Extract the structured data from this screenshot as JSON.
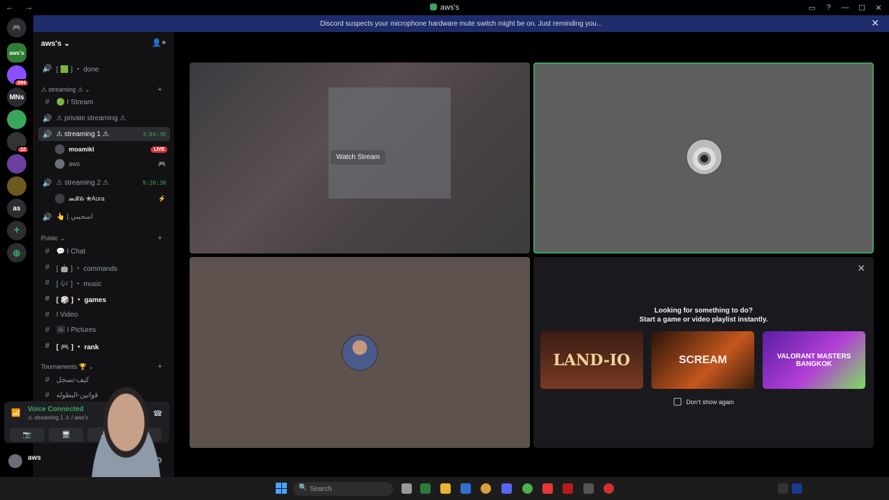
{
  "window": {
    "title": "aws's",
    "nav_arrows": "← →",
    "controls": [
      "▭",
      "?",
      "—",
      "☐",
      "✕"
    ]
  },
  "banner": {
    "text": "Discord suspects your microphone hardware mute switch might be on. Just reminding you...",
    "close": "✕"
  },
  "guilds": [
    {
      "label": "",
      "color": "#5865f2"
    },
    {
      "label": "aws's",
      "color": "#2e7d32"
    },
    {
      "label": "",
      "color": "#8a4fff",
      "badge": "294"
    },
    {
      "label": "MNs",
      "color": "#2b2d31"
    },
    {
      "label": "",
      "color": "#3ba55c"
    },
    {
      "label": "",
      "color": "#333",
      "badge": "12"
    },
    {
      "label": "",
      "color": "#6a3fa0"
    },
    {
      "label": "",
      "color": "#6b5a20"
    },
    {
      "label": "as",
      "color": "#2b2d31"
    },
    {
      "label": "+",
      "color": "#2b2d31"
    },
    {
      "label": "⊕",
      "color": "#2b2d31"
    }
  ],
  "server": {
    "name": "aws's ⌄",
    "add_icon": "👤+"
  },
  "channels": {
    "top": [
      {
        "icon": "🔊",
        "label": "[ 🟩 ] ・ done"
      }
    ],
    "cat_streaming": "⚠ streaming ⚠ ⌄",
    "streaming": [
      {
        "icon": "#",
        "label": "🟢 I Stream"
      },
      {
        "icon": "🔊",
        "label": "⚠ private streaming ⚠"
      },
      {
        "icon": "🔊",
        "label": "⚠ streaming 1 ⚠",
        "time": "3:04:36"
      }
    ],
    "streaming1_users": [
      {
        "name": "moamikl",
        "live": "LIVE"
      },
      {
        "name": "aws",
        "icon": "🎮"
      }
    ],
    "streaming2": {
      "icon": "🔊",
      "label": "⚠ streaming 2 ⚠",
      "time": "9:20:30"
    },
    "streaming2_users": [
      {
        "name": "𝓶𝓧𝓽𝓬 ❀Aura",
        "icon": "⚡"
      }
    ],
    "other_voice": {
      "icon": "🔊",
      "label": "👆 | اسحبني"
    },
    "cat_public": "Public ⌄",
    "public": [
      {
        "icon": "#",
        "label": "💬 I Chat"
      },
      {
        "icon": "#",
        "label": "[ 🤖 ] ・ commands"
      },
      {
        "icon": "#",
        "label": "[ 🎶 ] ・ music"
      },
      {
        "icon": "#",
        "label": "[ 🎲 ] ・ games",
        "bold": true
      },
      {
        "icon": "#",
        "label": "I Video"
      },
      {
        "icon": "#",
        "label": "🖼 I Pictures"
      },
      {
        "icon": "#",
        "label": "[ 🎮 ] ・ rank",
        "bold": true
      }
    ],
    "cat_tournaments": "Tournaments 🏆 ⌄",
    "tournaments": [
      {
        "icon": "#",
        "label": "كيف-تسجل"
      },
      {
        "icon": "#",
        "label": "قوانين-البطوله"
      }
    ]
  },
  "voice_panel": {
    "status": "Voice Connected",
    "sub": "⚠ streaming 1 ⚠ / aws's",
    "buttons": [
      "📷",
      "🖥",
      "✨",
      "🎵"
    ]
  },
  "user_panel": {
    "name": "aws",
    "gear": "⚙"
  },
  "tiles": {
    "watch_stream": "Watch Stream"
  },
  "activity": {
    "heading1": "Looking for something to do?",
    "heading2": "Start a game or video playlist instantly.",
    "cards": [
      "LAND-IO",
      "SCREAM",
      "VALORANT MASTERS BANGKOK"
    ],
    "dont_show": "Don't show again",
    "close": "✕"
  },
  "taskbar": {
    "search_placeholder": "Search"
  }
}
